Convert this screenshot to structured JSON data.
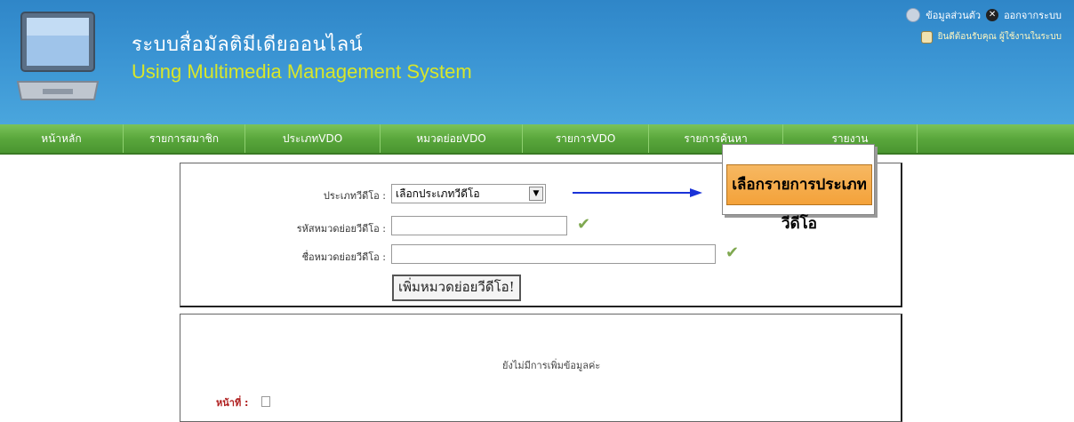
{
  "header": {
    "title_th": "ระบบสื่อมัลติมีเดียออนไลน์",
    "title_en": "Using Multimedia Management System",
    "profile_link": "ข้อมูลส่วนตัว",
    "logout_link": "ออกจากระบบ",
    "login_info": "ยินดีต้อนรับคุณ ผู้ใช้งานในระบบ"
  },
  "nav": {
    "items": [
      {
        "label": "หน้าหลัก"
      },
      {
        "label": "รายการสมาชิก"
      },
      {
        "label": "ประเภทVDO"
      },
      {
        "label": "หมวดย่อยVDO"
      },
      {
        "label": "รายการVDO"
      },
      {
        "label": "รายการค้นหา"
      },
      {
        "label": "รายงาน"
      }
    ]
  },
  "callout": {
    "text": "เลือกรายการประเภทวีดีโอ"
  },
  "form": {
    "type_label": "ประเภทวีดีโอ :",
    "type_value": "เลือกประเภทวีดีโอ",
    "code_label": "รหัสหมวดย่อยวีดีโอ :",
    "name_label": "ชื่อหมวดย่อยวีดีโอ :",
    "submit_label": "เพิ่มหมวดย่อยวีดีโอ!"
  },
  "list": {
    "empty_message": "ยังไม่มีการเพิ่มข้อมูลค่ะ",
    "page_label": "หน้าที่ :"
  }
}
